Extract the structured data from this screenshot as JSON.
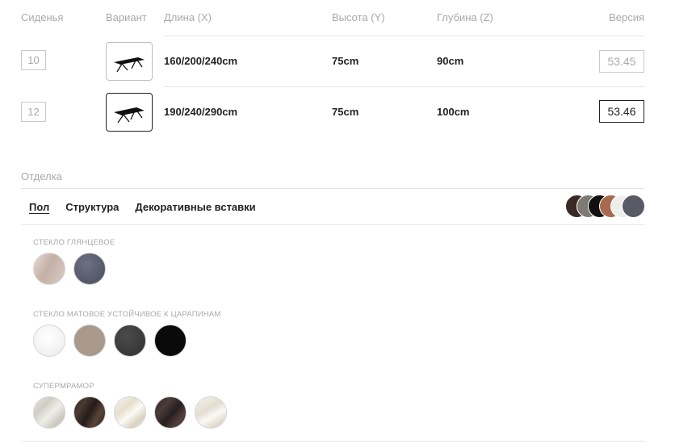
{
  "headers": {
    "seats": "Сиденья",
    "variant": "Вариант",
    "length": "Длина (X)",
    "height": "Высота (Y)",
    "depth": "Глубина (Z)",
    "version": "Версия"
  },
  "rows": [
    {
      "seats": "10",
      "length": "160/200/240cm",
      "height": "75cm",
      "depth": "90cm",
      "version": "53.45",
      "selected": false
    },
    {
      "seats": "12",
      "length": "190/240/290cm",
      "height": "75cm",
      "depth": "100cm",
      "version": "53.46",
      "selected": true
    }
  ],
  "finish": {
    "label": "Отделка",
    "tabs": [
      "Пол",
      "Структура",
      "Декоративные вставки"
    ],
    "active_tab": 0,
    "selected_stack_colors": [
      "#3a2a26",
      "#7d7a73",
      "#111111",
      "#a86a4f",
      "#eeeeea",
      "#5a5a66"
    ],
    "groups": [
      {
        "name": "Стекло глянцевое",
        "swatches": [
          "#c7b5ac",
          "#575a6b"
        ]
      },
      {
        "name": "Стекло матовое устойчивое к царапинам",
        "swatches": [
          "#f3f4f3",
          "#a8998a",
          "#3d3d3d",
          "#0a0a0a"
        ]
      },
      {
        "name": "Супермрамор",
        "swatches": [
          "#dcdad2",
          "#2f2623",
          "#f4f1ea",
          "#34282a",
          "#f3f1ec"
        ]
      }
    ]
  }
}
